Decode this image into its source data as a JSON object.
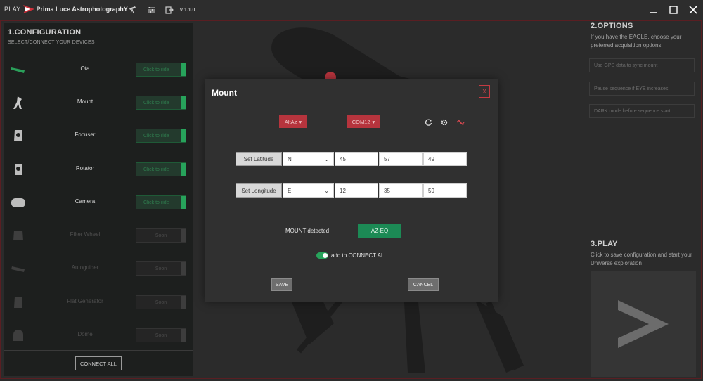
{
  "titlebar": {
    "brand_play": "PLAY",
    "brand_name": "Prima Luce AstrophotographY",
    "version": "v 1.1.0",
    "icons": [
      "telescope-icon",
      "sliders-icon",
      "export-icon"
    ]
  },
  "config": {
    "title": "1.CONFIGURATION",
    "subtitle": "SELECT/CONNECT YOUR DEVICES",
    "devices": [
      {
        "name": "Ota",
        "button": "Click to ride",
        "status": "available",
        "icon": "ota-icon"
      },
      {
        "name": "Mount",
        "button": "Click to ride",
        "status": "available",
        "icon": "mount-icon"
      },
      {
        "name": "Focuser",
        "button": "Click to ride",
        "status": "available",
        "icon": "focuser-icon"
      },
      {
        "name": "Rotator",
        "button": "Click to ride",
        "status": "available",
        "icon": "rotator-icon"
      },
      {
        "name": "Camera",
        "button": "Click to ride",
        "status": "available",
        "icon": "camera-icon"
      },
      {
        "name": "Filter Wheel",
        "button": "Soon",
        "status": "soon",
        "icon": "filter-wheel-icon"
      },
      {
        "name": "Autoguider",
        "button": "Soon",
        "status": "soon",
        "icon": "autoguider-icon"
      },
      {
        "name": "Flat Generator",
        "button": "Soon",
        "status": "soon",
        "icon": "flat-generator-icon"
      },
      {
        "name": "Dome",
        "button": "Soon",
        "status": "soon",
        "icon": "dome-icon"
      }
    ],
    "connect_all": "CONNECT ALL"
  },
  "options": {
    "title": "2.OPTIONS",
    "description": "If you have the EAGLE, choose your preferred acquisition options",
    "items": [
      "Use GPS data to sync mount",
      "Pause sequence if EYE increases",
      "DARK mode before sequence start"
    ]
  },
  "play": {
    "title": "3.PLAY",
    "description": "Click to save configuration and start your Universe exploration"
  },
  "modal": {
    "title": "Mount",
    "close": "X",
    "mount_type": "AltAz",
    "port": "COM12",
    "latitude": {
      "label": "Set Latitude",
      "hemisphere": "N",
      "deg": "45",
      "min": "57",
      "sec": "49"
    },
    "longitude": {
      "label": "Set Longitude",
      "hemisphere": "E",
      "deg": "12",
      "min": "35",
      "sec": "59"
    },
    "detected_label": "MOUNT detected",
    "detected_value": "AZ-EQ",
    "toggle_label": "add to CONNECT ALL",
    "save": "SAVE",
    "cancel": "CANCEL"
  },
  "colors": {
    "accent_red": "#b6343d",
    "accent_green": "#27a35b",
    "detected_green": "#1c8a55"
  }
}
